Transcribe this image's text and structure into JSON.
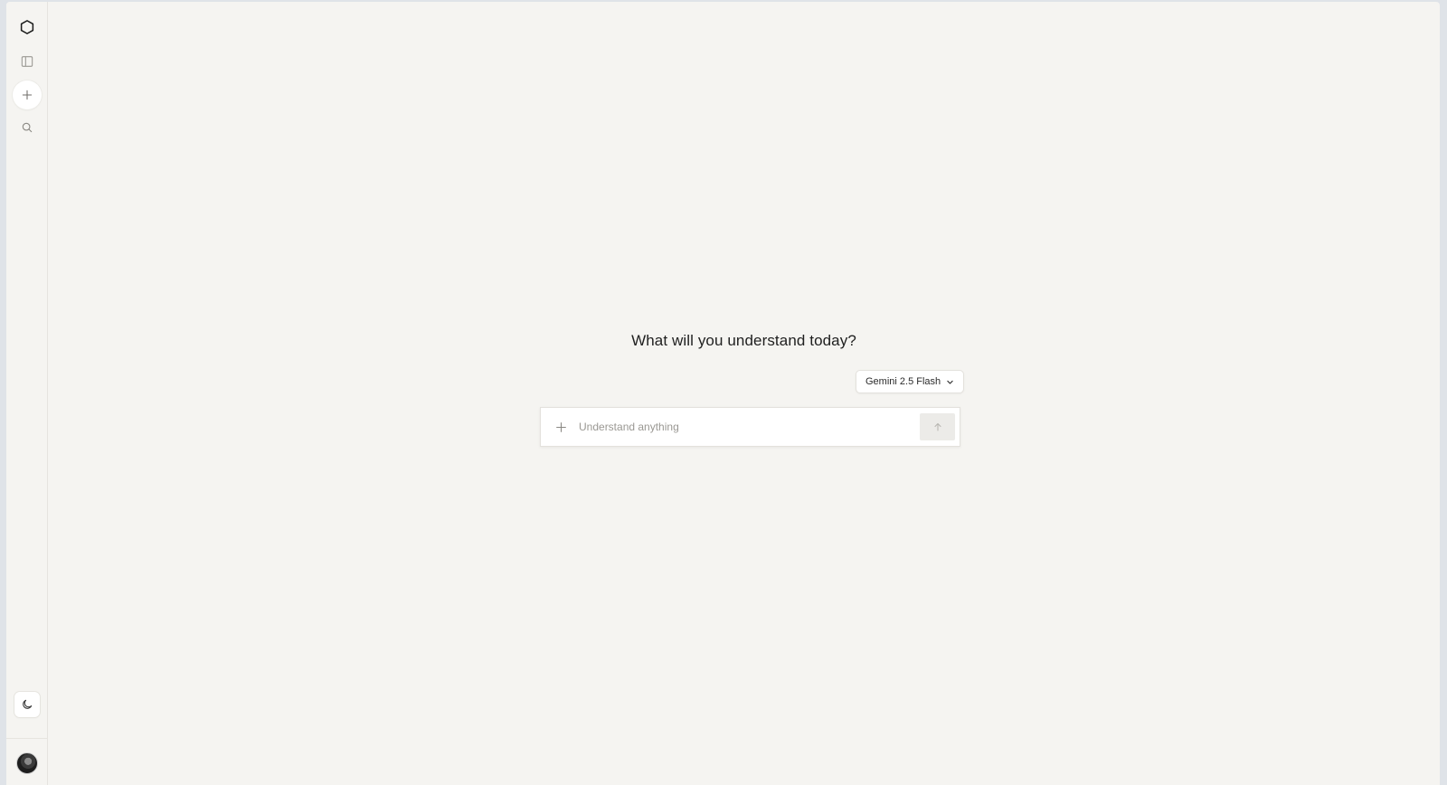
{
  "sidebar": {
    "logo_icon": "hexagon-icon",
    "toggle_icon": "sidebar-panel-icon",
    "new_chat_icon": "plus-icon",
    "search_icon": "search-icon",
    "theme_icon": "moon-icon",
    "avatar_icon": "user-avatar"
  },
  "main": {
    "headline": "What will you understand today?",
    "model_selector": {
      "selected": "Gemini 2.5 Flash",
      "icon": "chevron-down-icon"
    },
    "composer": {
      "attach_icon": "plus-icon",
      "placeholder": "Understand anything",
      "value": "",
      "send_icon": "arrow-up-icon"
    }
  },
  "colors": {
    "background": "#f5f4f1",
    "surface": "#ffffff",
    "border": "#e3e1dc",
    "text": "#1f1f1f",
    "placeholder": "#9a9893",
    "send_disabled": "#ecebe8"
  }
}
